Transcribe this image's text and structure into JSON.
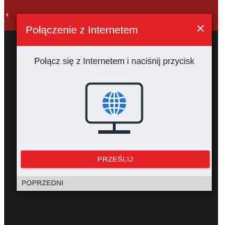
{
  "app": {
    "back_glyph": "‹"
  },
  "dialog": {
    "title": "Połączenie z Internetem",
    "close_glyph": "×",
    "instruction": "Połącz się z Internetem i naciśnij przycisk",
    "illustration_icon": "monitor-globe-icon",
    "submit_label": "PRZEŚLIJ",
    "previous_label": "POPRZEDNI"
  },
  "colors": {
    "accent_red": "#e32228",
    "dark_red_header": "#8f1a1a",
    "illustration_blue": "#2277d8",
    "illustration_outline": "#202d36",
    "backdrop": "#1b1b1b"
  }
}
